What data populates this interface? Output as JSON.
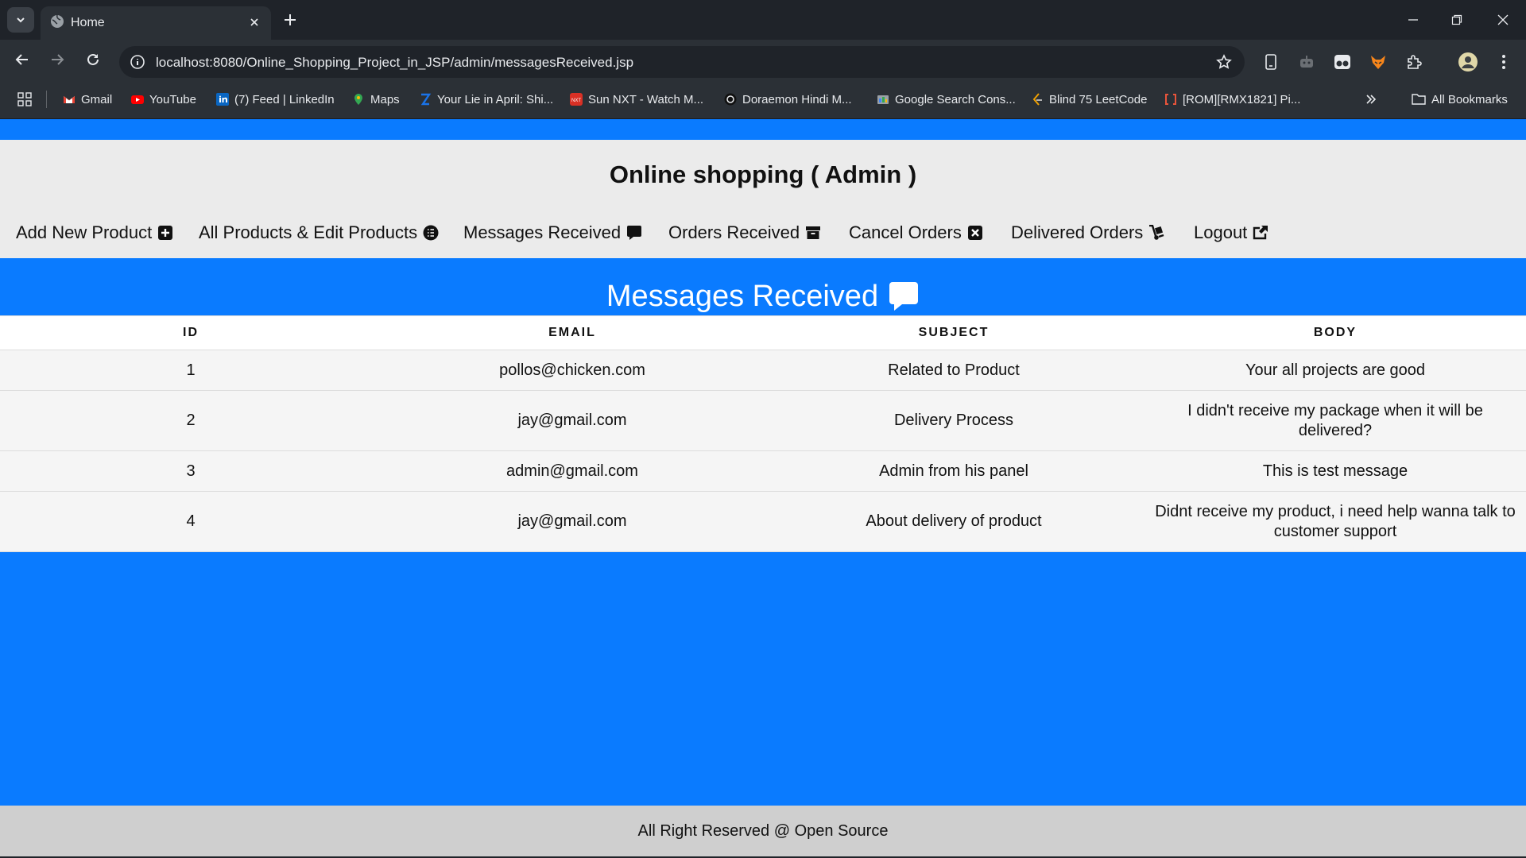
{
  "browser": {
    "tab_title": "Home",
    "url": "localhost:8080/Online_Shopping_Project_in_JSP/admin/messagesReceived.jsp",
    "bookmarks": [
      {
        "label": "Gmail",
        "icon": "gmail-icon",
        "color": "#ea4335"
      },
      {
        "label": "YouTube",
        "icon": "youtube-icon",
        "color": "#ff0000"
      },
      {
        "label": "(7) Feed | LinkedIn",
        "icon": "linkedin-icon",
        "color": "#0a66c2"
      },
      {
        "label": "Maps",
        "icon": "maps-icon",
        "color": "#34a853"
      },
      {
        "label": "Your Lie in April: Shi...",
        "icon": "site-icon",
        "color": "#1a73e8"
      },
      {
        "label": "Sun NXT - Watch M...",
        "icon": "sunnxt-icon",
        "color": "#d93025"
      },
      {
        "label": "Doraemon Hindi M...",
        "icon": "doraemon-icon",
        "color": "#222222"
      },
      {
        "label": "Google Search Cons...",
        "icon": "search-console-icon",
        "color": "#9aa0a6"
      },
      {
        "label": "Blind 75 LeetCode",
        "icon": "leetcode-icon",
        "color": "#f0a000"
      },
      {
        "label": "[ROM][RMX1821] Pi...",
        "icon": "xda-icon",
        "color": "#e8543b"
      }
    ],
    "all_bookmarks_label": "All Bookmarks"
  },
  "header": {
    "brand": "Online shopping ( Admin )",
    "nav": [
      {
        "label": "Add New Product",
        "icon": "plus-square-icon"
      },
      {
        "label": "All Products & Edit Products",
        "icon": "list-circle-icon"
      },
      {
        "label": "Messages Received",
        "icon": "comment-icon"
      },
      {
        "label": "Orders Received",
        "icon": "archive-icon"
      },
      {
        "label": "Cancel Orders",
        "icon": "close-square-icon"
      },
      {
        "label": "Delivered Orders",
        "icon": "dolly-icon"
      },
      {
        "label": "Logout",
        "icon": "share-square-icon"
      }
    ]
  },
  "main": {
    "title": "Messages Received",
    "title_icon": "comment-icon",
    "columns": [
      "ID",
      "EMAIL",
      "SUBJECT",
      "BODY"
    ],
    "rows": [
      {
        "id": "1",
        "email": "pollos@chicken.com",
        "subject": "Related to Product",
        "body": "Your all projects are good"
      },
      {
        "id": "2",
        "email": "jay@gmail.com",
        "subject": "Delivery Process",
        "body": "I didn't receive my package when it will be delivered?"
      },
      {
        "id": "3",
        "email": "admin@gmail.com",
        "subject": "Admin from his panel",
        "body": "This is test message"
      },
      {
        "id": "4",
        "email": "jay@gmail.com",
        "subject": "About delivery of product",
        "body": "Didnt receive my product, i need help wanna talk to customer support"
      }
    ]
  },
  "footer": {
    "text": "All Right Reserved @ Open Source"
  },
  "colors": {
    "page_blue": "#0a7bff",
    "header_gray": "#ebebeb",
    "footer_gray": "#cfcfcf",
    "chrome_dark": "#1f2329",
    "chrome_mid": "#2b3036"
  }
}
